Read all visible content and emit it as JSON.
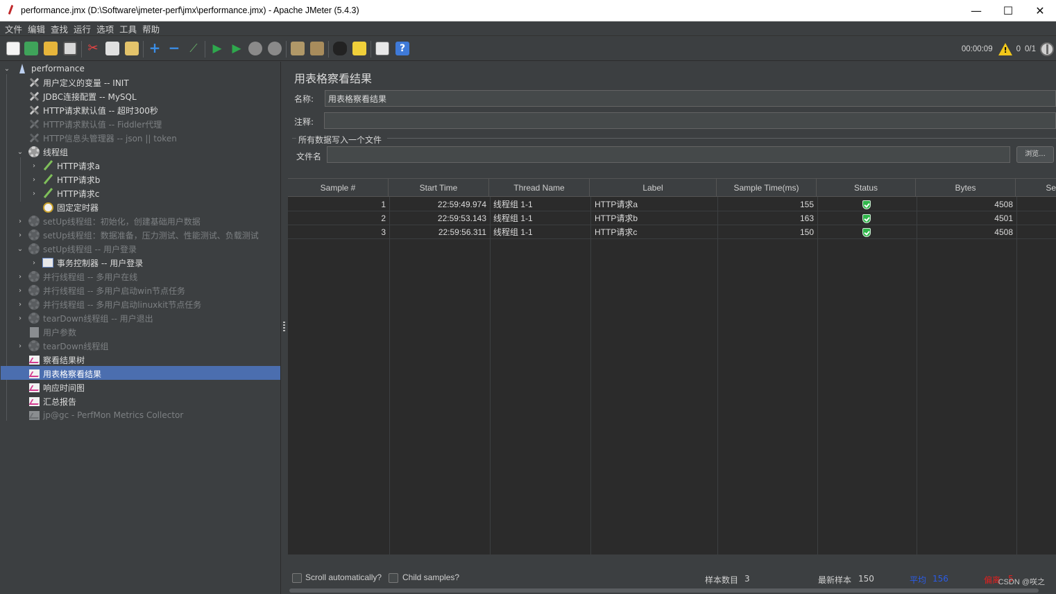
{
  "window": {
    "title": "performance.jmx (D:\\Software\\jmeter-perf\\jmx\\performance.jmx) - Apache JMeter (5.4.3)",
    "minimize": "—",
    "maximize": "☐",
    "close": "✕"
  },
  "menu": [
    "文件",
    "编辑",
    "查找",
    "运行",
    "选项",
    "工具",
    "帮助"
  ],
  "toolbar": {
    "elapsed": "00:00:09",
    "warnings": "0",
    "threads": "0/1",
    "icons": [
      "new-icon",
      "templates-icon",
      "open-icon",
      "save-icon",
      "cut-icon",
      "copy-icon",
      "paste-icon",
      "expand-icon",
      "collapse-icon",
      "toggle-icon",
      "start-icon",
      "start-no-pause-icon",
      "stop-icon",
      "shutdown-icon",
      "clear-icon",
      "clear-all-icon",
      "search-icon",
      "reset-search-icon",
      "function-helper-icon",
      "help-icon"
    ]
  },
  "tree": {
    "root": "performance",
    "nodes": [
      "用户定义的变量 -- INIT",
      "JDBC连接配置 -- MySQL",
      "HTTP请求默认值 -- 超时300秒",
      "HTTP请求默认值 -- Fiddler代理",
      "HTTP信息头管理器 -- json || token",
      "线程组",
      "HTTP请求a",
      "HTTP请求b",
      "HTTP请求c",
      "固定定时器",
      "setUp线程组：初始化，创建基础用户数据",
      "setUp线程组：数据准备，压力测试、性能测试、负载测试",
      "setUp线程组 -- 用户登录",
      "事务控制器 -- 用户登录",
      "并行线程组 -- 多用户在线",
      "并行线程组 -- 多用户启动win节点任务",
      "并行线程组 -- 多用户启动linuxkit节点任务",
      "tearDown线程组 -- 用户退出",
      "用户参数",
      "tearDown线程组",
      "察看结果树",
      "用表格察看结果",
      "响应时间图",
      "汇总报告",
      "jp@gc - PerfMon Metrics Collector"
    ]
  },
  "panel": {
    "title": "用表格察看结果",
    "name_label": "名称:",
    "name_value": "用表格察看结果",
    "comment_label": "注释:",
    "comment_value": "",
    "file_group_label": "所有数据写入一个文件",
    "filename_label": "文件名",
    "filename_value": "",
    "browse_label": "浏览..."
  },
  "table": {
    "columns": [
      "Sample #",
      "Start Time",
      "Thread Name",
      "Label",
      "Sample Time(ms)",
      "Status",
      "Bytes",
      "Se"
    ],
    "rows": [
      {
        "sample": "1",
        "start": "22:59:49.974",
        "thread": "线程组 1-1",
        "label": "HTTP请求a",
        "time": "155",
        "status": "success",
        "bytes": "4508"
      },
      {
        "sample": "2",
        "start": "22:59:53.143",
        "thread": "线程组 1-1",
        "label": "HTTP请求b",
        "time": "163",
        "status": "success",
        "bytes": "4501"
      },
      {
        "sample": "3",
        "start": "22:59:56.311",
        "thread": "线程组 1-1",
        "label": "HTTP请求c",
        "time": "150",
        "status": "success",
        "bytes": "4508"
      }
    ]
  },
  "bottom": {
    "scroll_auto": "Scroll automatically?",
    "child_samples": "Child samples?",
    "sample_count_label": "样本数目",
    "sample_count": "3",
    "latest_label": "最新样本",
    "latest": "150",
    "avg_label": "平均",
    "avg": "156",
    "dev_label": "偏离",
    "dev": "5",
    "colors": {
      "avg": "#2b5ce6",
      "dev": "#e0201e"
    }
  },
  "watermark": "CSDN @咲之"
}
